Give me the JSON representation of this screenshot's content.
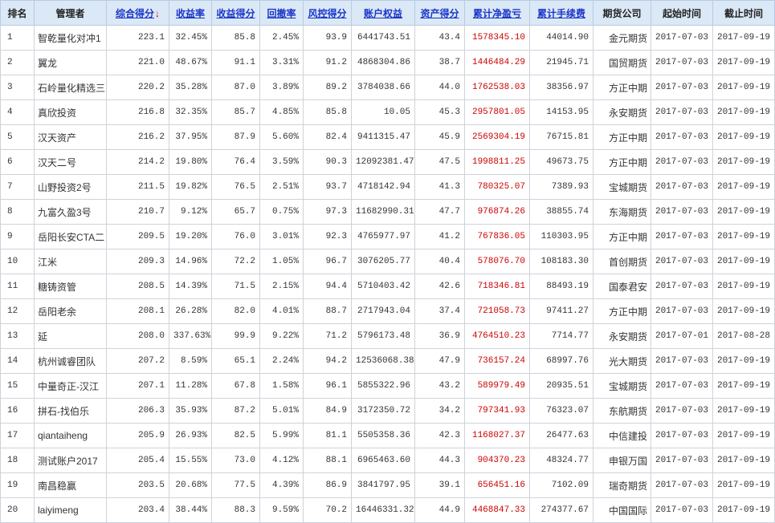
{
  "colors": {
    "header_bg": "#dbe8f6",
    "header_text": "#222222",
    "link": "#1a36c8",
    "arrow": "#e00000",
    "pnl": "#cc0000",
    "text": "#333333",
    "border": "#cdd3da"
  },
  "table": {
    "columns": [
      {
        "key": "rank",
        "label": "排名",
        "link": false
      },
      {
        "key": "manager",
        "label": "管理者",
        "link": false
      },
      {
        "key": "total_score",
        "label": "综合得分",
        "link": true,
        "sort_indicator": "↓"
      },
      {
        "key": "return_rate",
        "label": "收益率",
        "link": true
      },
      {
        "key": "return_score",
        "label": "收益得分",
        "link": true
      },
      {
        "key": "drawdown",
        "label": "回撤率",
        "link": true
      },
      {
        "key": "risk_score",
        "label": "风控得分",
        "link": true
      },
      {
        "key": "equity",
        "label": "账户权益",
        "link": true
      },
      {
        "key": "asset_score",
        "label": "资产得分",
        "link": true
      },
      {
        "key": "net_pnl",
        "label": "累计净盈亏",
        "link": true
      },
      {
        "key": "fees",
        "label": "累计手续费",
        "link": true
      },
      {
        "key": "broker",
        "label": "期货公司",
        "link": false
      },
      {
        "key": "start_date",
        "label": "起始时间",
        "link": false
      },
      {
        "key": "end_date",
        "label": "截止时间",
        "link": false
      }
    ],
    "rows": [
      {
        "rank": "1",
        "manager": "智乾量化对冲1",
        "total_score": "223.1",
        "return_rate": "32.45%",
        "return_score": "85.8",
        "drawdown": "2.45%",
        "risk_score": "93.9",
        "equity": "6441743.51",
        "asset_score": "43.4",
        "net_pnl": "1578345.10",
        "fees": "44014.90",
        "broker": "金元期货",
        "start_date": "2017-07-03",
        "end_date": "2017-09-19"
      },
      {
        "rank": "2",
        "manager": "翼龙",
        "total_score": "221.0",
        "return_rate": "48.67%",
        "return_score": "91.1",
        "drawdown": "3.31%",
        "risk_score": "91.2",
        "equity": "4868304.86",
        "asset_score": "38.7",
        "net_pnl": "1446484.29",
        "fees": "21945.71",
        "broker": "国贸期货",
        "start_date": "2017-07-03",
        "end_date": "2017-09-19"
      },
      {
        "rank": "3",
        "manager": "石岭量化精选三",
        "total_score": "220.2",
        "return_rate": "35.28%",
        "return_score": "87.0",
        "drawdown": "3.89%",
        "risk_score": "89.2",
        "equity": "3784038.66",
        "asset_score": "44.0",
        "net_pnl": "1762538.03",
        "fees": "38356.97",
        "broker": "方正中期",
        "start_date": "2017-07-03",
        "end_date": "2017-09-19"
      },
      {
        "rank": "4",
        "manager": "真欣投资",
        "total_score": "216.8",
        "return_rate": "32.35%",
        "return_score": "85.7",
        "drawdown": "4.85%",
        "risk_score": "85.8",
        "equity": "10.05",
        "asset_score": "45.3",
        "net_pnl": "2957801.05",
        "fees": "14153.95",
        "broker": "永安期货",
        "start_date": "2017-07-03",
        "end_date": "2017-09-19"
      },
      {
        "rank": "5",
        "manager": "汉天资产",
        "total_score": "216.2",
        "return_rate": "37.95%",
        "return_score": "87.9",
        "drawdown": "5.60%",
        "risk_score": "82.4",
        "equity": "9411315.47",
        "asset_score": "45.9",
        "net_pnl": "2569304.19",
        "fees": "76715.81",
        "broker": "方正中期",
        "start_date": "2017-07-03",
        "end_date": "2017-09-19"
      },
      {
        "rank": "6",
        "manager": "汉天二号",
        "total_score": "214.2",
        "return_rate": "19.80%",
        "return_score": "76.4",
        "drawdown": "3.59%",
        "risk_score": "90.3",
        "equity": "12092381.47",
        "asset_score": "47.5",
        "net_pnl": "1998811.25",
        "fees": "49673.75",
        "broker": "方正中期",
        "start_date": "2017-07-03",
        "end_date": "2017-09-19"
      },
      {
        "rank": "7",
        "manager": "山野投资2号",
        "total_score": "211.5",
        "return_rate": "19.82%",
        "return_score": "76.5",
        "drawdown": "2.51%",
        "risk_score": "93.7",
        "equity": "4718142.94",
        "asset_score": "41.3",
        "net_pnl": "780325.07",
        "fees": "7389.93",
        "broker": "宝城期货",
        "start_date": "2017-07-03",
        "end_date": "2017-09-19"
      },
      {
        "rank": "8",
        "manager": "九富久盈3号",
        "total_score": "210.7",
        "return_rate": "9.12%",
        "return_score": "65.7",
        "drawdown": "0.75%",
        "risk_score": "97.3",
        "equity": "11682990.31",
        "asset_score": "47.7",
        "net_pnl": "976874.26",
        "fees": "38855.74",
        "broker": "东海期货",
        "start_date": "2017-07-03",
        "end_date": "2017-09-19"
      },
      {
        "rank": "9",
        "manager": "岳阳长安CTA二",
        "total_score": "209.5",
        "return_rate": "19.20%",
        "return_score": "76.0",
        "drawdown": "3.01%",
        "risk_score": "92.3",
        "equity": "4765977.97",
        "asset_score": "41.2",
        "net_pnl": "767836.05",
        "fees": "110303.95",
        "broker": "方正中期",
        "start_date": "2017-07-03",
        "end_date": "2017-09-19"
      },
      {
        "rank": "10",
        "manager": "江米",
        "total_score": "209.3",
        "return_rate": "14.96%",
        "return_score": "72.2",
        "drawdown": "1.05%",
        "risk_score": "96.7",
        "equity": "3076205.77",
        "asset_score": "40.4",
        "net_pnl": "578076.70",
        "fees": "108183.30",
        "broker": "首创期货",
        "start_date": "2017-07-03",
        "end_date": "2017-09-19"
      },
      {
        "rank": "11",
        "manager": "糖铸资管",
        "total_score": "208.5",
        "return_rate": "14.39%",
        "return_score": "71.5",
        "drawdown": "2.15%",
        "risk_score": "94.4",
        "equity": "5710403.42",
        "asset_score": "42.6",
        "net_pnl": "718346.81",
        "fees": "88493.19",
        "broker": "国泰君安",
        "start_date": "2017-07-03",
        "end_date": "2017-09-19"
      },
      {
        "rank": "12",
        "manager": "岳阳老余",
        "total_score": "208.1",
        "return_rate": "26.28%",
        "return_score": "82.0",
        "drawdown": "4.01%",
        "risk_score": "88.7",
        "equity": "2717943.04",
        "asset_score": "37.4",
        "net_pnl": "721058.73",
        "fees": "97411.27",
        "broker": "方正中期",
        "start_date": "2017-07-03",
        "end_date": "2017-09-19"
      },
      {
        "rank": "13",
        "manager": "延",
        "total_score": "208.0",
        "return_rate": "337.63%",
        "return_score": "99.9",
        "drawdown": "9.22%",
        "risk_score": "71.2",
        "equity": "5796173.48",
        "asset_score": "36.9",
        "net_pnl": "4764510.23",
        "fees": "7714.77",
        "broker": "永安期货",
        "start_date": "2017-07-01",
        "end_date": "2017-08-28"
      },
      {
        "rank": "14",
        "manager": "杭州诚睿团队",
        "total_score": "207.2",
        "return_rate": "8.59%",
        "return_score": "65.1",
        "drawdown": "2.24%",
        "risk_score": "94.2",
        "equity": "12536068.38",
        "asset_score": "47.9",
        "net_pnl": "736157.24",
        "fees": "68997.76",
        "broker": "光大期货",
        "start_date": "2017-07-03",
        "end_date": "2017-09-19"
      },
      {
        "rank": "15",
        "manager": "中量奇正-汉江",
        "total_score": "207.1",
        "return_rate": "11.28%",
        "return_score": "67.8",
        "drawdown": "1.58%",
        "risk_score": "96.1",
        "equity": "5855322.96",
        "asset_score": "43.2",
        "net_pnl": "589979.49",
        "fees": "20935.51",
        "broker": "宝城期货",
        "start_date": "2017-07-03",
        "end_date": "2017-09-19"
      },
      {
        "rank": "16",
        "manager": "拼石-找伯乐",
        "total_score": "206.3",
        "return_rate": "35.93%",
        "return_score": "87.2",
        "drawdown": "5.01%",
        "risk_score": "84.9",
        "equity": "3172350.72",
        "asset_score": "34.2",
        "net_pnl": "797341.93",
        "fees": "76323.07",
        "broker": "东航期货",
        "start_date": "2017-07-03",
        "end_date": "2017-09-19"
      },
      {
        "rank": "17",
        "manager": "qiantaiheng",
        "total_score": "205.9",
        "return_rate": "26.93%",
        "return_score": "82.5",
        "drawdown": "5.99%",
        "risk_score": "81.1",
        "equity": "5505358.36",
        "asset_score": "42.3",
        "net_pnl": "1168027.37",
        "fees": "26477.63",
        "broker": "中信建投",
        "start_date": "2017-07-03",
        "end_date": "2017-09-19"
      },
      {
        "rank": "18",
        "manager": "测试账户2017",
        "total_score": "205.4",
        "return_rate": "15.55%",
        "return_score": "73.0",
        "drawdown": "4.12%",
        "risk_score": "88.1",
        "equity": "6965463.60",
        "asset_score": "44.3",
        "net_pnl": "904370.23",
        "fees": "48324.77",
        "broker": "申银万国",
        "start_date": "2017-07-03",
        "end_date": "2017-09-19"
      },
      {
        "rank": "19",
        "manager": "南昌稳赢",
        "total_score": "203.5",
        "return_rate": "20.68%",
        "return_score": "77.5",
        "drawdown": "4.39%",
        "risk_score": "86.9",
        "equity": "3841797.95",
        "asset_score": "39.1",
        "net_pnl": "656451.16",
        "fees": "7102.09",
        "broker": "瑞奇期货",
        "start_date": "2017-07-03",
        "end_date": "2017-09-19"
      },
      {
        "rank": "20",
        "manager": "laiyimeng",
        "total_score": "203.4",
        "return_rate": "38.44%",
        "return_score": "88.3",
        "drawdown": "9.59%",
        "risk_score": "70.2",
        "equity": "16446331.32",
        "asset_score": "44.9",
        "net_pnl": "4468847.33",
        "fees": "274377.67",
        "broker": "中国国际",
        "start_date": "2017-07-03",
        "end_date": "2017-09-19"
      }
    ]
  }
}
